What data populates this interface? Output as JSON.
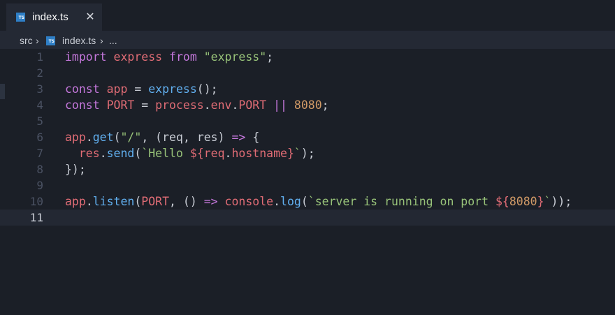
{
  "tab": {
    "icon_text": "TS",
    "label": "index.ts",
    "close_glyph": "✕"
  },
  "breadcrumb": {
    "folder": "src",
    "file": "index.ts",
    "ellipsis": "...",
    "chevron": "›"
  },
  "editor": {
    "current_line": 11,
    "lines": [
      {
        "n": "1"
      },
      {
        "n": "2"
      },
      {
        "n": "3"
      },
      {
        "n": "4"
      },
      {
        "n": "5"
      },
      {
        "n": "6"
      },
      {
        "n": "7"
      },
      {
        "n": "8"
      },
      {
        "n": "9"
      },
      {
        "n": "10"
      },
      {
        "n": "11"
      }
    ],
    "tokens": {
      "l1": [
        "import",
        "express",
        "from",
        "\"express\"",
        ";"
      ],
      "l3": [
        "const",
        "app",
        "=",
        "express",
        "();"
      ],
      "l4": [
        "const",
        "PORT",
        "=",
        "process",
        ".",
        "env",
        ".",
        "PORT",
        "||",
        "8080",
        ";"
      ],
      "l6": [
        "app",
        ".",
        "get",
        "(",
        "\"/\"",
        ", (",
        "req",
        ", ",
        "res",
        ")",
        "=>",
        "{"
      ],
      "l7": [
        "res",
        ".",
        "send",
        "(",
        "`Hello ",
        "${",
        "req",
        ".",
        "hostname",
        "}",
        "`",
        ");"
      ],
      "l8": [
        "});"
      ],
      "l10": [
        "app",
        ".",
        "listen",
        "(",
        "PORT",
        ", () ",
        "=>",
        "console",
        ".",
        "log",
        "(",
        "`server is running on port ",
        "${",
        "8080",
        "}",
        "`",
        "));"
      ]
    }
  },
  "colors": {
    "background": "#1b1f27",
    "tab_active": "#242934",
    "keyword": "#c678dd",
    "variable": "#e06c75",
    "function": "#61afef",
    "string": "#98c379",
    "number": "#d19a66"
  }
}
